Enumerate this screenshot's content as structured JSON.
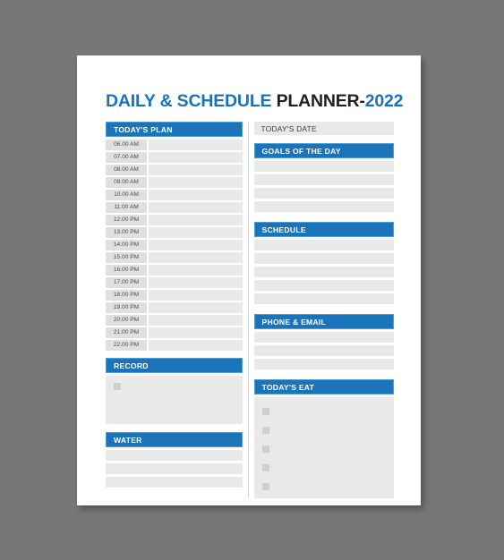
{
  "page": {
    "title_blue": "DAILY & SCHEDULE ",
    "title_dark": "PLANNER-",
    "title_year": "2022",
    "background_color": "#777777",
    "sheet_color": "#ffffff",
    "accent_color": "#1b74ba",
    "accent_border_color": "#4f9dd4",
    "field_gray": "#e9e9e9",
    "label_gray": "#e0e0e0",
    "header_gray": "#e8e8e8"
  },
  "left_column": {
    "todays_plan": {
      "header": "TODAY'S PLAN",
      "times": [
        "06.00 AM",
        "07.00 AM",
        "08.00 AM",
        "09.00 AM",
        "10.00 AM",
        "11.00 AM",
        "12.00 PM",
        "13.00 PM",
        "14.00 PM",
        "15.00 PM",
        "16.00 PM",
        "17.00 PM",
        "18.00 PM",
        "19.00 PM",
        "20.00 PM",
        "21.00 PM",
        "22.00 PM"
      ]
    },
    "record": {
      "header": "RECORD",
      "checkbox_count": 1
    },
    "water": {
      "header": "WATER",
      "row_count": 3
    }
  },
  "right_column": {
    "todays_date": {
      "header": "TODAY'S DATE"
    },
    "goals_of_the_day": {
      "header": "GOALS OF THE DAY",
      "row_count": 4
    },
    "schedule": {
      "header": "SCHEDULE",
      "row_count": 5
    },
    "phone_email": {
      "header": "PHONE & EMAIL",
      "row_count": 3
    },
    "todays_eat": {
      "header": "TODAY'S EAT",
      "checkbox_count": 5
    }
  }
}
